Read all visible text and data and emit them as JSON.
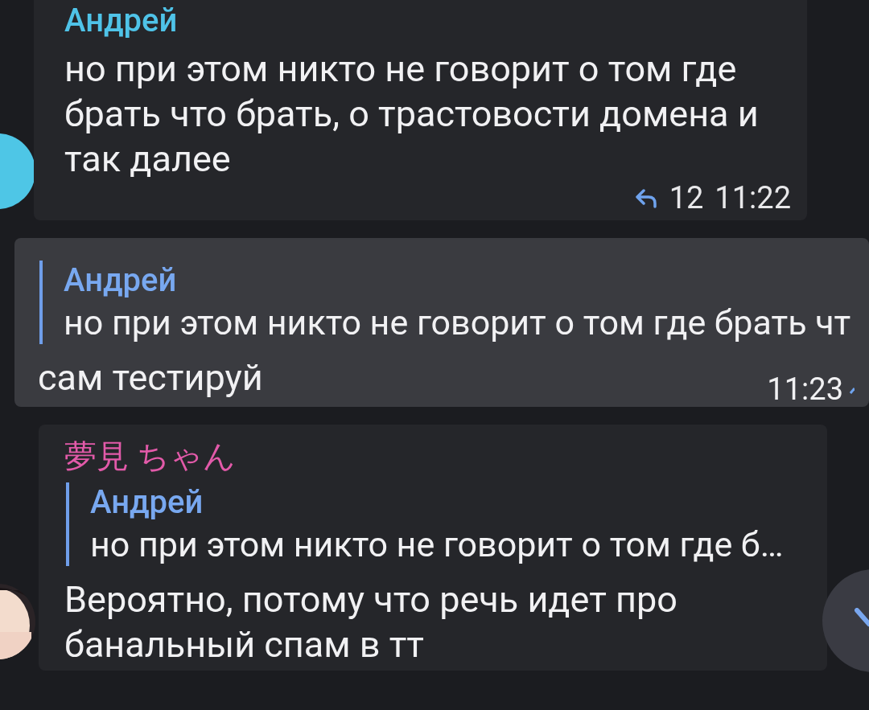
{
  "messages": [
    {
      "kind": "incoming",
      "avatar": {
        "kind": "circle",
        "color": "#4ec6e6"
      },
      "sender": {
        "name": "Андрей",
        "color": "#4fc3e8"
      },
      "text": "но при этом никто не говорит о том где брать что брать, о трастовости домена и так далее",
      "replies": "12",
      "time": "11:22"
    },
    {
      "kind": "outgoing",
      "reply": {
        "name": "Андрей",
        "text": "но при этом никто не говорит о том где брать чт"
      },
      "text": "сам тестируй",
      "time": "11:23"
    },
    {
      "kind": "incoming",
      "sender": {
        "name": "夢見 ちゃん",
        "color": "#e25aa9"
      },
      "reply": {
        "name": "Андрей",
        "text": "но при этом никто не говорит о том где б…"
      },
      "text": "Вероятно, потому что речь идет про банальный спам в тт"
    }
  ]
}
